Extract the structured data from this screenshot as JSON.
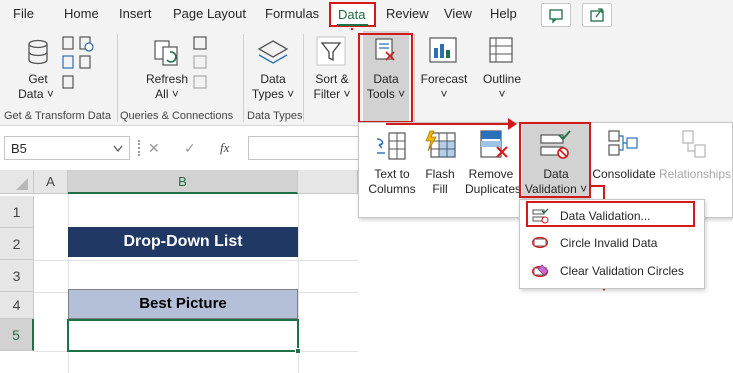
{
  "menu": {
    "file": "File",
    "home": "Home",
    "insert": "Insert",
    "page_layout": "Page Layout",
    "formulas": "Formulas",
    "data": "Data",
    "review": "Review",
    "view": "View",
    "help": "Help"
  },
  "ribbon": {
    "get_data_1": "Get",
    "get_data_2": "Data ˅",
    "refresh_1": "Refresh",
    "refresh_2": "All ˅",
    "data_types_1": "Data",
    "data_types_2": "Types ˅",
    "sort_filter_1": "Sort &",
    "sort_filter_2": "Filter ˅",
    "data_tools_1": "Data",
    "data_tools_2": "Tools ˅",
    "forecast_1": "Forecast",
    "forecast_2": "˅",
    "outline_1": "Outline",
    "outline_2": "˅",
    "groups": {
      "get_transform": "Get & Transform Data",
      "queries": "Queries & Connections",
      "data_types": "Data Types"
    }
  },
  "formula_bar": {
    "name_box": "B5",
    "cancel": "✕",
    "enter": "✓",
    "fx": "fx"
  },
  "sheet": {
    "col_a": "A",
    "col_b": "B",
    "rows": [
      "1",
      "2",
      "3",
      "4",
      "5"
    ],
    "title": "Drop-Down List",
    "header": "Best Picture"
  },
  "data_tools_popup": {
    "text_to_columns_1": "Text to",
    "text_to_columns_2": "Columns",
    "flash_fill_1": "Flash",
    "flash_fill_2": "Fill",
    "remove_dup_1": "Remove",
    "remove_dup_2": "Duplicates",
    "data_validation_1": "Data",
    "data_validation_2": "Validation ˅",
    "consolidate": "Consolidate",
    "relationships": "Relationships"
  },
  "validation_menu": {
    "items": [
      "Data Validation...",
      "Circle Invalid Data",
      "Clear Validation Circles"
    ]
  },
  "colors": {
    "accent_green": "#1e7145",
    "highlight_red": "#d11a1a",
    "title_fill": "#1f3864",
    "header_fill": "#b4c0d8"
  }
}
